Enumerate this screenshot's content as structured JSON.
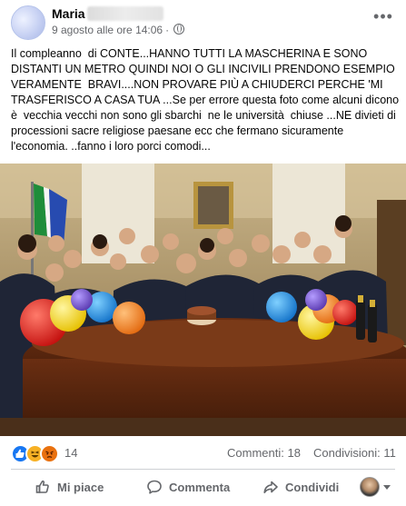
{
  "post": {
    "author": "Maria",
    "timestamp": "9 agosto alle ore 14:06",
    "separator": "·",
    "text": "Il compleanno  di CONTE...HANNO TUTTI LA MASCHERINA E SONO DISTANTI UN METRO QUINDI NOI O GLI INCIVILI PRENDONO ESEMPIO VERAMENTE  BRAVI....NON PROVARE PIÙ A CHIUDERCI PERCHE 'MI TRASFERISCO A CASA TUA ...Se per errore questa foto come alcuni dicono è  vecchia vecchi non sono gli sbarchi  ne le università  chiuse ...NE divieti di processioni sacre religiose paesane ecc che fermano sicuramente  l'economia. ..fanno i loro porci comodi..."
  },
  "reactions": {
    "types": [
      "like-icon",
      "haha-icon",
      "angry-icon"
    ],
    "count": "14",
    "comments": "Commenti: 18",
    "shares": "Condivisioni: 11"
  },
  "actions": {
    "like": "Mi piace",
    "comment": "Commenta",
    "share": "Condividi"
  },
  "colors": {
    "like_blue": "#1877f2",
    "haha_yellow": "#f7b125",
    "angry_orange": "#e9710f",
    "secondary_text": "#65676b"
  }
}
